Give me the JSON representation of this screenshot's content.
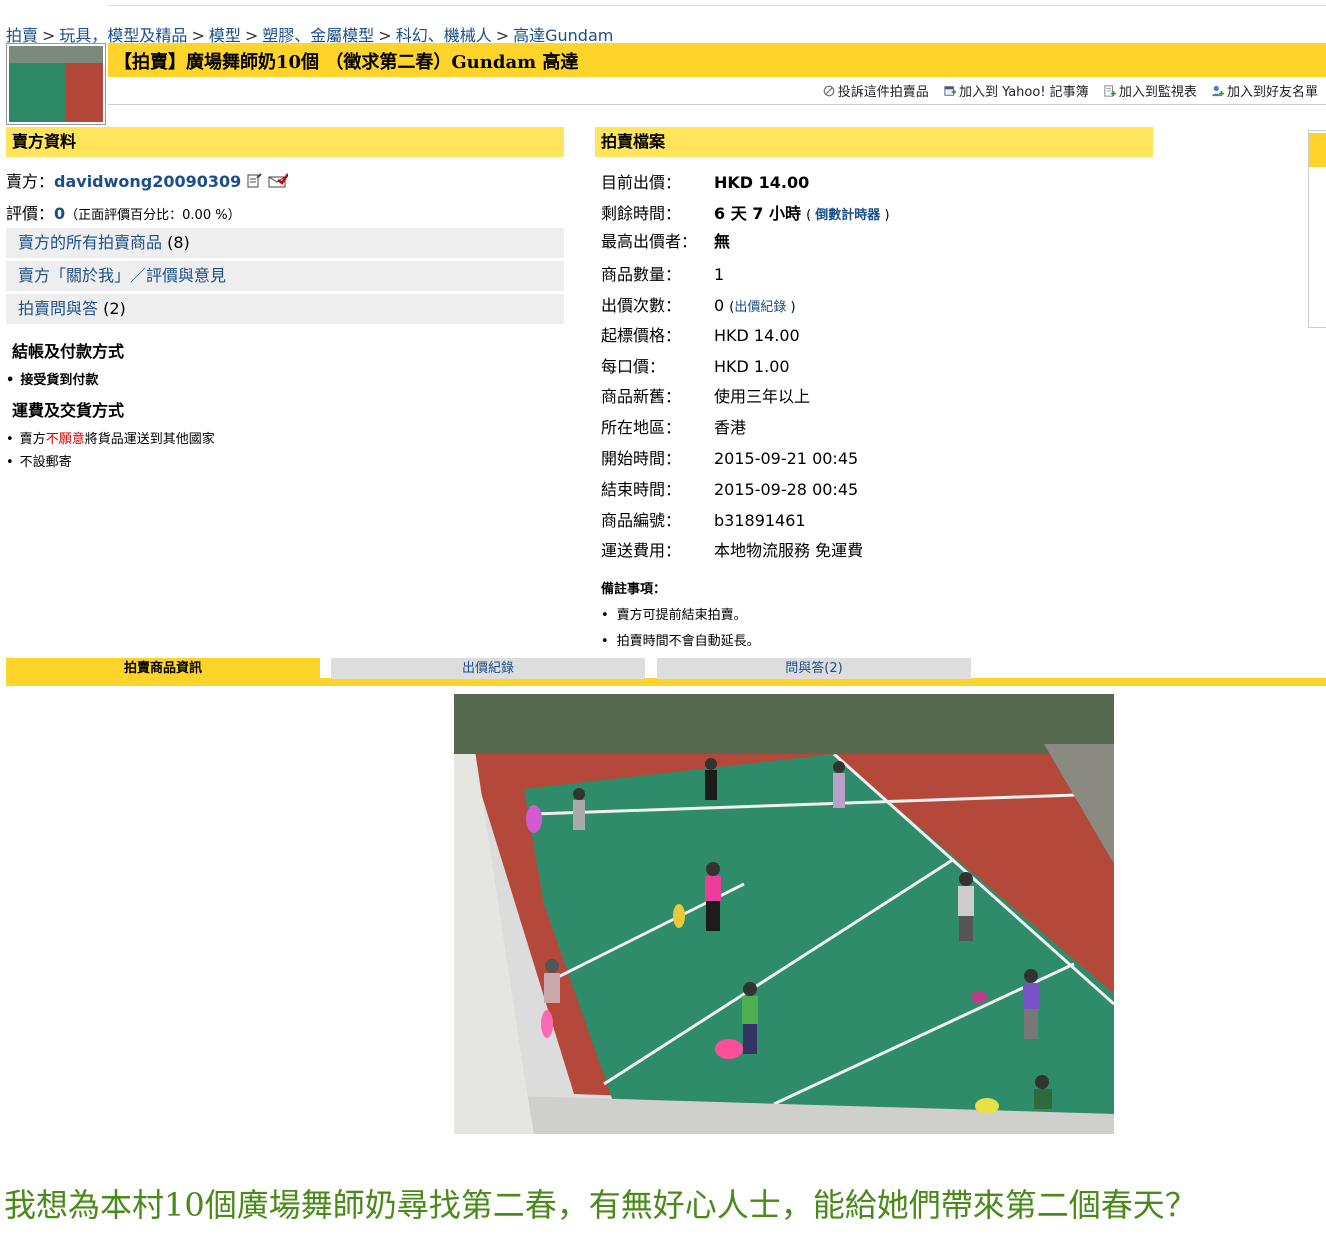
{
  "breadcrumb": [
    "拍賣",
    "玩具，模型及精品",
    "模型",
    "塑膠、金屬模型",
    "科幻、機械人",
    "高達Gundam"
  ],
  "breadcrumb_sep": ">",
  "title": "【拍賣】廣場舞師奶10個 （徵求第二春）Gundam 高達",
  "actions": {
    "report": "投訴這件拍賣品",
    "yahoo_notebook": "加入到 Yahoo! 記事簿",
    "watchlist": "加入到監視表",
    "friends": "加入到好友名單"
  },
  "seller": {
    "header": "賣方資料",
    "seller_label": "賣方：",
    "seller_name": "davidwong20090309",
    "rating_label": "評價：",
    "rating_value": "0",
    "rating_pct": "（正面評價百分比：0.00 %）",
    "links": [
      {
        "label": "賣方的所有拍賣商品",
        "count": "(8)"
      },
      {
        "label": "賣方「關於我」／評價與意見",
        "count": ""
      },
      {
        "label": "拍賣問與答",
        "count": "(2)"
      }
    ],
    "payment_header": "結帳及付款方式",
    "payment_items": [
      "接受貨到付款"
    ],
    "shipping_header": "運費及交貨方式",
    "shipping_item1_pre": "賣方",
    "shipping_item1_red": "不願意",
    "shipping_item1_post": "將貨品運送到其他國家",
    "shipping_item2": "不設郵寄"
  },
  "auction": {
    "header": "拍賣檔案",
    "rows": [
      {
        "k": "目前出價：",
        "v": "HKD 14.00"
      },
      {
        "k": "剩餘時間：",
        "v": "6 天 7 小時",
        "extra": "倒數計時器"
      },
      {
        "k": "最高出價者：",
        "v": "無"
      },
      {
        "k": "商品數量：",
        "v": "1"
      },
      {
        "k": "出價次數：",
        "v": "0",
        "extra": "出價紀錄"
      },
      {
        "k": "起標價格：",
        "v": "HKD 14.00"
      },
      {
        "k": "每口價：",
        "v": "HKD 1.00"
      },
      {
        "k": "商品新舊：",
        "v": "使用三年以上"
      },
      {
        "k": "所在地區：",
        "v": "香港"
      },
      {
        "k": "開始時間：",
        "v": "2015-09-21 00:45"
      },
      {
        "k": "結束時間：",
        "v": "2015-09-28 00:45"
      },
      {
        "k": "商品編號：",
        "v": "b31891461"
      },
      {
        "k": "運送費用：",
        "v": "本地物流服務 免運費"
      }
    ],
    "notes_header": "備註事項：",
    "notes": [
      "賣方可提前結束拍賣。",
      "拍賣時間不會自動延長。"
    ]
  },
  "tabs": [
    "拍賣商品資訊",
    "出價紀錄",
    "問與答(2)"
  ],
  "caption": "我想為本村10個廣場舞師奶尋找第二春，有無好心人士，能給她們帶來第二個春天？",
  "colors": {
    "yellow": "#ffd42a",
    "link": "#1a4f8a",
    "caption_green": "#4a8a1a"
  }
}
